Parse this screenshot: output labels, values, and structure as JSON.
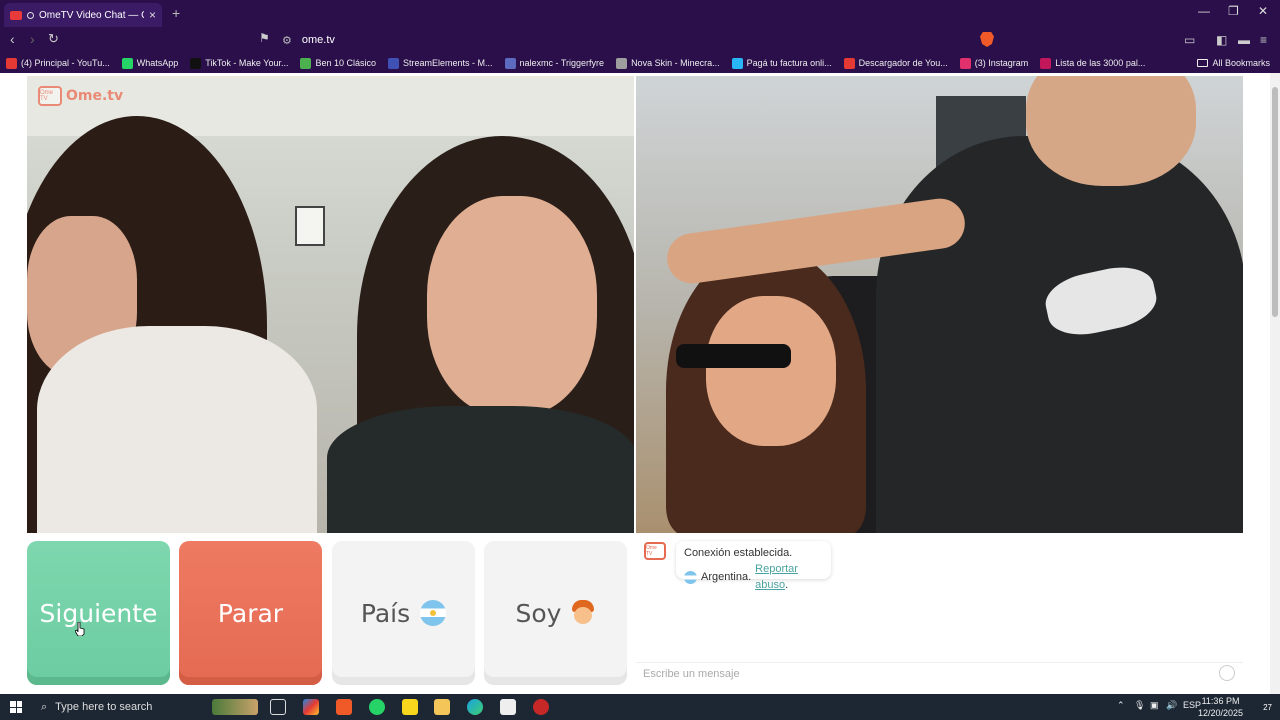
{
  "browser": {
    "tab_title": "OmeTV Video Chat — Omeg",
    "url": "ome.tv",
    "window_controls": [
      "—",
      "❐",
      "✕"
    ],
    "bookmarks": [
      {
        "label": "(4) Principal - YouTu...",
        "color": "#e53935"
      },
      {
        "label": "WhatsApp",
        "color": "#25d366"
      },
      {
        "label": "TikTok - Make Your...",
        "color": "#111111"
      },
      {
        "label": "Ben 10 Clásico",
        "color": "#4caf50"
      },
      {
        "label": "StreamElements - M...",
        "color": "#3f51b5"
      },
      {
        "label": "nalexmc - Triggerfyre",
        "color": "#5c6bc0"
      },
      {
        "label": "Nova Skin - Minecra...",
        "color": "#9e9e9e"
      },
      {
        "label": "Pagá tu factura onli...",
        "color": "#29b6f6"
      },
      {
        "label": "Descargador de You...",
        "color": "#e53935"
      },
      {
        "label": "(3) Instagram",
        "color": "#e1306c"
      },
      {
        "label": "Lista de las 3000 pal...",
        "color": "#c2185b"
      }
    ],
    "all_bookmarks": "All Bookmarks"
  },
  "page": {
    "logo_text": "Ome.tv",
    "logo_badge": "Ome TV",
    "buttons": {
      "next": "Siguiente",
      "stop": "Parar",
      "country": "País",
      "me": "Soy"
    },
    "chat": {
      "status": "Conexión establecida.",
      "country": "Argentina.",
      "report_link": "Reportar abuso",
      "report_suffix": ".",
      "message_placeholder": "Escribe un mensaje"
    }
  },
  "taskbar": {
    "search_placeholder": "Type here to search",
    "language": "ESP",
    "time": "11:36 PM",
    "date": "12/20/2025",
    "notifications": "27"
  }
}
